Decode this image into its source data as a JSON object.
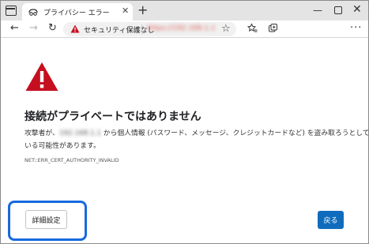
{
  "tab": {
    "title": "プライバシー エラー",
    "close_glyph": "✕",
    "new_tab_glyph": "+"
  },
  "window_controls": {
    "minimize": "—",
    "close": "✕"
  },
  "toolbar": {
    "back_glyph": "←",
    "forward_glyph": "→",
    "refresh_glyph": "↻",
    "security_label": "セキュリティ保護なし",
    "url": "https://192.168.1.1",
    "favorite_glyph": "☆",
    "more_glyph": "···"
  },
  "page": {
    "heading": "接続がプライベートではありません",
    "description_before": "攻撃者が、",
    "description_host": "192.168.1.1",
    "description_after": " から個人情報 (パスワード、メッセージ、クレジットカードなど) を盗み取ろうとして",
    "description_line2": "いる可能性があります。",
    "error_code": "NET::ERR_CERT_AUTHORITY_INVALID",
    "advanced_button": "詳細設定",
    "back_button": "戻る"
  },
  "colors": {
    "warning_red": "#c50f1f",
    "back_button_blue": "#0f6cbd",
    "highlight_blue": "#1769e0",
    "url_red": "#d7574f"
  },
  "icons": [
    "tab-actions-icon",
    "incognito-mask-icon",
    "back-arrow-icon",
    "forward-arrow-icon",
    "refresh-icon",
    "warning-triangle-icon",
    "favorite-star-icon",
    "favorites-icon",
    "collections-icon",
    "more-options-icon"
  ]
}
